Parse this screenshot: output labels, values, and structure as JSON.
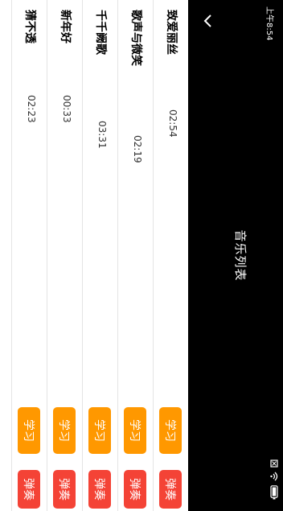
{
  "status_bar": {
    "time": "上午8:54",
    "icons": [
      "notification-icon",
      "wifi-icon",
      "battery-icon"
    ]
  },
  "header": {
    "title": "音乐列表",
    "back_icon": "chevron-down-icon"
  },
  "songs": [
    {
      "name": "致爱丽丝",
      "duration": "02:54",
      "learn_label": "学习",
      "play_label": "弹奏"
    },
    {
      "name": "歌声与微笑",
      "duration": "02:19",
      "learn_label": "学习",
      "play_label": "弹奏"
    },
    {
      "name": "千千阙歌",
      "duration": "03:31",
      "learn_label": "学习",
      "play_label": "弹奏"
    },
    {
      "name": "新年好",
      "duration": "00:33",
      "learn_label": "学习",
      "play_label": "弹奏"
    },
    {
      "name": "猜不透",
      "duration": "02:23",
      "learn_label": "学习",
      "play_label": "弹奏"
    }
  ],
  "colors": {
    "learn_button": "#ff9800",
    "play_button": "#f44336",
    "bar": "#000000"
  }
}
